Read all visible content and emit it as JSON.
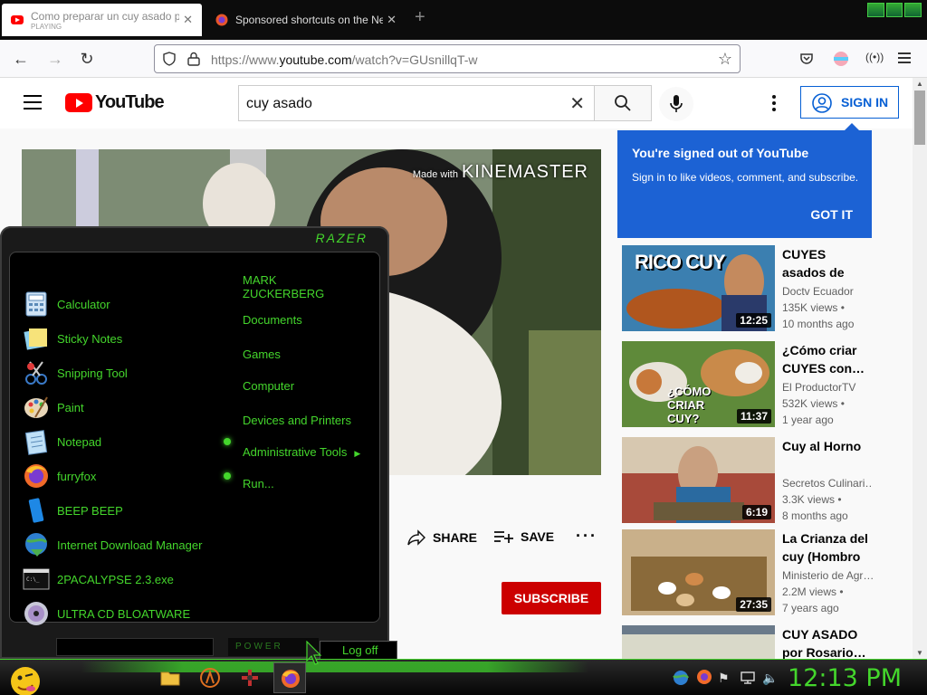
{
  "browser": {
    "tabs": [
      {
        "title": "Como preparar un cuy asado p",
        "sub": "PLAYING",
        "active": true
      },
      {
        "title": "Sponsored shortcuts on the Ne",
        "active": false
      }
    ],
    "url_prefix": "https://www.",
    "url_host": "youtube.com",
    "url_path": "/watch?v=GUsnillqT-w"
  },
  "youtube": {
    "logo_text": "YouTube",
    "search_query": "cuy asado",
    "sign_in": "SIGN IN",
    "watermark_small": "Made with",
    "watermark": "KINEMASTER",
    "share": "SHARE",
    "save": "SAVE",
    "subscribe": "SUBSCRIBE",
    "popup": {
      "heading": "You're signed out of YouTube",
      "text": "Sign in to like videos, comment, and subscribe.",
      "button": "GOT IT"
    },
    "recommendations": [
      {
        "title": "CUYES asados de Cuenca",
        "channel": "Doctv Ecuador",
        "views": "135K views •",
        "age": "10 months ago",
        "duration": "12:25",
        "thumb_text": "RICO CUY"
      },
      {
        "title": "¿Cómo criar CUYES con…",
        "channel": "El ProductorTV",
        "views": "532K views •",
        "age": "1 year ago",
        "duration": "11:37",
        "thumb_text": "¿CÓMO CRIAR CUY?"
      },
      {
        "title": "Cuy al Horno",
        "channel": "Secretos Culinari…",
        "views": "3.3K views •",
        "age": "8 months ago",
        "duration": "6:19",
        "thumb_text": ""
      },
      {
        "title": "La Crianza del cuy (Hombro …",
        "channel": "Ministerio de Agr…",
        "views": "2.2M views •",
        "age": "7 years ago",
        "duration": "27:35",
        "thumb_text": ""
      },
      {
        "title": "CUY ASADO por Rosario…",
        "channel": "",
        "views": "",
        "age": "",
        "duration": "",
        "thumb_text": ""
      }
    ]
  },
  "start_menu": {
    "brand": "RAZER",
    "programs": [
      {
        "label": "Calculator",
        "icon": "calculator-icon",
        "arrow": false
      },
      {
        "label": "Sticky Notes",
        "icon": "sticky-notes-icon",
        "arrow": false
      },
      {
        "label": "Snipping Tool",
        "icon": "scissors-icon",
        "arrow": false
      },
      {
        "label": "Paint",
        "icon": "paint-palette-icon",
        "arrow": false
      },
      {
        "label": "Notepad",
        "icon": "notepad-icon",
        "arrow": true
      },
      {
        "label": "furryfox",
        "icon": "firefox-icon",
        "arrow": true
      },
      {
        "label": "BEEP BEEP",
        "icon": "blue-app-icon",
        "arrow": false
      },
      {
        "label": "Internet Download Manager",
        "icon": "globe-download-icon",
        "arrow": false
      },
      {
        "label": "2PACALYPSE 2.3.exe",
        "icon": "console-icon",
        "arrow": false
      },
      {
        "label": "ULTRA CD BLOATWARE",
        "icon": "cd-icon",
        "arrow": false
      }
    ],
    "places": [
      {
        "label": "MARK ZUCKERBERG",
        "arrow": false
      },
      {
        "label": "Documents",
        "arrow": false
      },
      {
        "label": "Games",
        "arrow": false
      },
      {
        "label": "Computer",
        "arrow": false
      },
      {
        "label": "Devices and Printers",
        "arrow": false
      },
      {
        "label": "Administrative Tools",
        "arrow": true
      },
      {
        "label": "Run...",
        "arrow": false
      }
    ],
    "power_label": "POWER",
    "log_off": "Log off"
  },
  "taskbar": {
    "clock": "12:13 PM"
  },
  "colors": {
    "razer_green": "#44d62c",
    "yt_red": "#ff0000",
    "yt_blue": "#065fd4",
    "subscribe_red": "#cc0000"
  }
}
